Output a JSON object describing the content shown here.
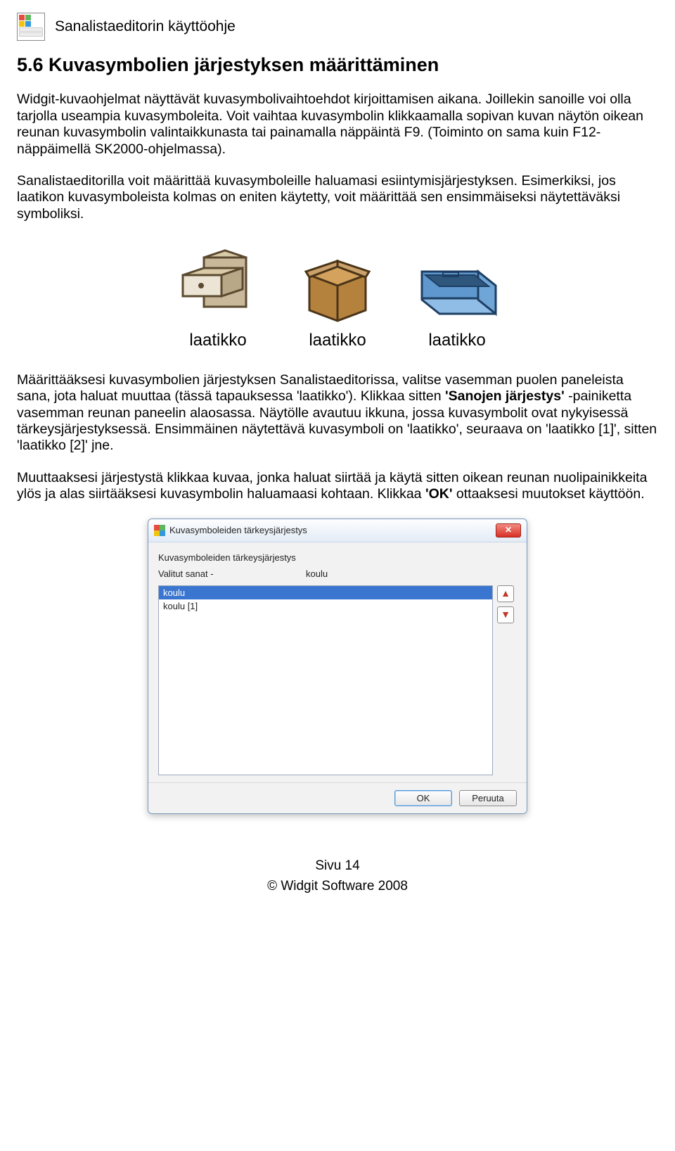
{
  "header": {
    "title": "Sanalistaeditorin käyttöohje"
  },
  "section_heading": "5.6 Kuvasymbolien järjestyksen määrittäminen",
  "para1": "Widgit-kuvaohjelmat näyttävät kuvasymbolivaihtoehdot kirjoittamisen aikana. Joillekin sanoille voi olla tarjolla useampia kuvasymboleita. Voit vaihtaa kuvasymbolin klikkaamalla sopivan kuvan näytön oikean reunan kuvasymbolin valintaikkunasta tai painamalla näppäintä F9. (Toiminto on sama kuin F12-näppäimellä SK2000-ohjelmassa).",
  "para2": "Sanalistaeditorilla voit määrittää kuvasymboleille haluamasi esiintymisjärjestyksen. Esimerkiksi, jos laatikon kuvasymboleista kolmas on eniten käytetty, voit määrittää sen ensimmäiseksi näytettäväksi symboliksi.",
  "symbols": [
    {
      "label": "laatikko"
    },
    {
      "label": "laatikko"
    },
    {
      "label": "laatikko"
    }
  ],
  "para3_pre": "Määrittääksesi kuvasymbolien järjestyksen Sanalistaeditorissa, valitse vasemman puolen paneleista sana, jota haluat muuttaa (tässä tapauksessa 'laatikko'). Klikkaa sitten ",
  "para3_bold1": "'Sanojen järjestys'",
  "para3_post": "-painiketta vasemman reunan paneelin alaosassa. Näytölle avautuu ikkuna, jossa kuvasymbolit ovat nykyisessä tärkeysjärjestyksessä. Ensimmäinen näytettävä kuvasymboli on 'laatikko', seuraava on 'laatikko [1]', sitten 'laatikko [2]' jne.",
  "para4_pre": "Muuttaaksesi järjestystä klikkaa kuvaa, jonka haluat siirtää ja käytä sitten oikean reunan nuolipainikkeita ylös ja alas siirtääksesi kuvasymbolin haluamaasi kohtaan. Klikkaa ",
  "para4_bold": "'OK'",
  "para4_post": " ottaaksesi muutokset käyttöön.",
  "dialog": {
    "title": "Kuvasymboleiden tärkeysjärjestys",
    "body_caption": "Kuvasymboleiden tärkeysjärjestys",
    "selected_label": "Valitut sanat -",
    "selected_value": "koulu",
    "items": [
      "koulu",
      "koulu [1]"
    ],
    "ok": "OK",
    "cancel": "Peruuta"
  },
  "footer": {
    "page": "Sivu 14",
    "copyright": "© Widgit Software 2008"
  }
}
